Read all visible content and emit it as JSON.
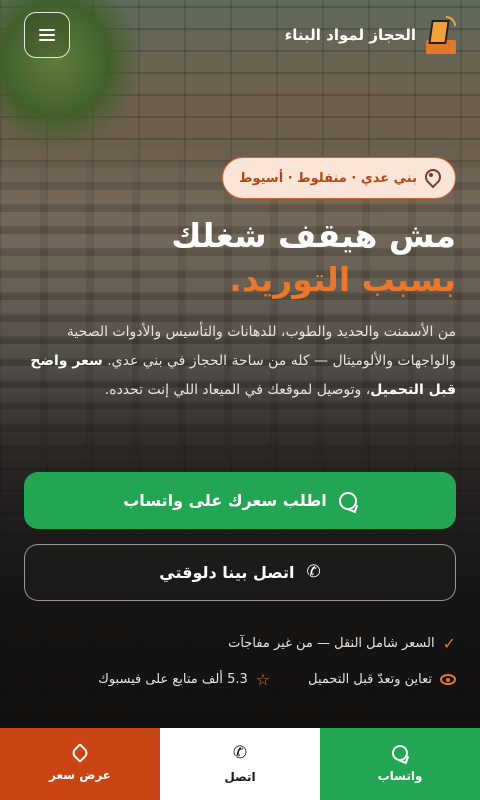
{
  "header": {
    "brand_name": "الحجاز لمواد البناء",
    "logo_icon": "brand-logo",
    "menu_icon": "hamburger-menu-icon"
  },
  "location": {
    "text": "بني عدي · منفلوط · أسيوط",
    "icon": "map-pin-icon"
  },
  "hero": {
    "headline_line1": "مش هيقف شغلك",
    "headline_line2": "بسبب التوريد.",
    "description_part1": "من الأسمنت والحديد والطوب، للدهانات والتأسيس والأدوات الصحية والواجهات والألوميتال — كله من ساحة الحجاز في بني عدي.",
    "description_bold": "سعر واضح قبل التحميل",
    "description_part2": "، وتوصيل لموقعك في الميعاد اللي إنت تحدده."
  },
  "buttons": {
    "whatsapp_label": "اطلب سعرك على واتساب",
    "call_label": "اتصل بينا دلوقتي"
  },
  "bullets": {
    "price_note": "السعر شامل النقل — من غير مفاجآت",
    "inspect_note": "تعاين وتعدّ قبل التحميل",
    "followers_note": "5.3 ألف متابع على فيسبوك"
  },
  "bottom_bar": {
    "whatsapp": "واتساب",
    "call": "اتصل",
    "offer": "عرض سعر"
  },
  "colors": {
    "accent": "#e9772c",
    "whatsapp_green": "#22a653",
    "offer_orange": "#cb4413",
    "pill_bg": "#fbe5d8"
  }
}
